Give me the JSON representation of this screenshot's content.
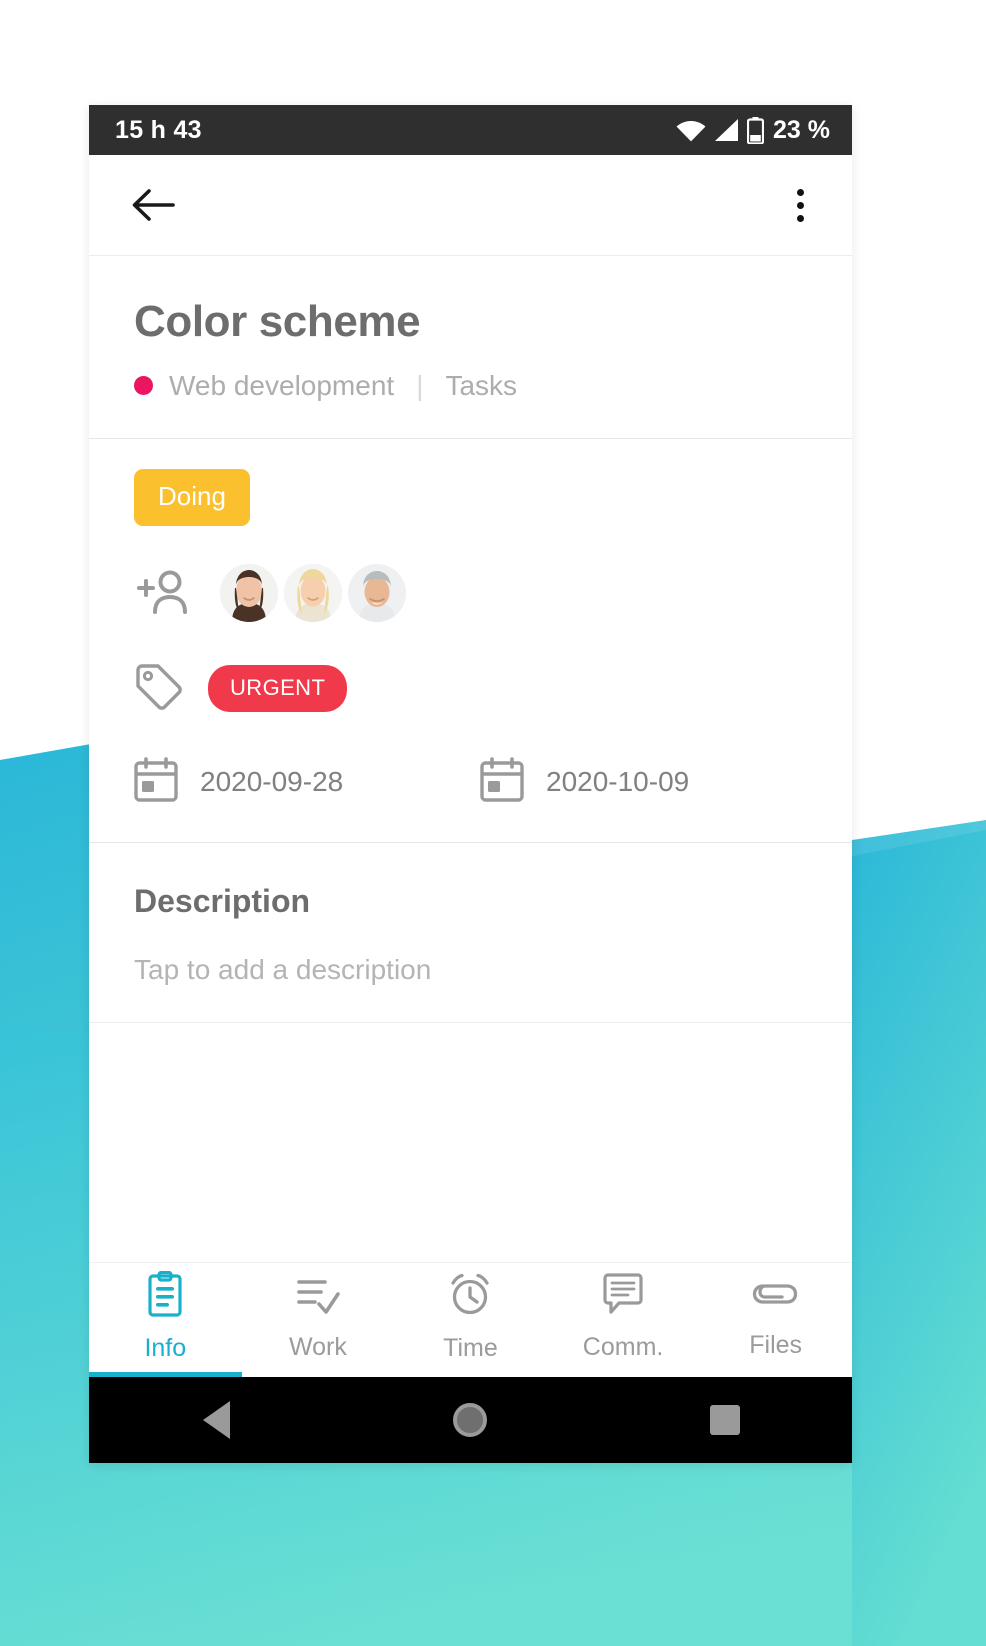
{
  "statusbar": {
    "clock": "15 h 43",
    "battery_text": "23 %",
    "icons": [
      "wifi-icon",
      "signal-icon",
      "battery-icon"
    ]
  },
  "toolbar": {
    "back_icon": "back-arrow-icon",
    "overflow_icon": "overflow-menu-icon"
  },
  "task": {
    "title": "Color scheme",
    "project": "Web development",
    "separator": "|",
    "category": "Tasks",
    "project_dot_color": "#ec1561"
  },
  "details": {
    "status_label": "Doing",
    "status_color": "#fbc02d",
    "add_person_icon": "add-person-icon",
    "assignees": [
      {
        "name": "assignee-1"
      },
      {
        "name": "assignee-2"
      },
      {
        "name": "assignee-3"
      }
    ],
    "tag_icon": "tag-icon",
    "tag_label": "URGENT",
    "tag_color": "#f03a4b",
    "start_date": "2020-09-28",
    "end_date": "2020-10-09",
    "calendar_icon": "calendar-icon"
  },
  "description": {
    "heading": "Description",
    "placeholder": "Tap to add a description"
  },
  "tabs": [
    {
      "label": "Info",
      "icon": "clipboard-icon",
      "active": true
    },
    {
      "label": "Work",
      "icon": "checklist-icon",
      "active": false
    },
    {
      "label": "Time",
      "icon": "alarm-clock-icon",
      "active": false
    },
    {
      "label": "Comm.",
      "icon": "comment-icon",
      "active": false
    },
    {
      "label": "Files",
      "icon": "paperclip-icon",
      "active": false
    }
  ],
  "accent_color": "#19b0cc",
  "navbar": {
    "back": "nav-back-icon",
    "home": "nav-home-icon",
    "recents": "nav-recents-icon"
  }
}
